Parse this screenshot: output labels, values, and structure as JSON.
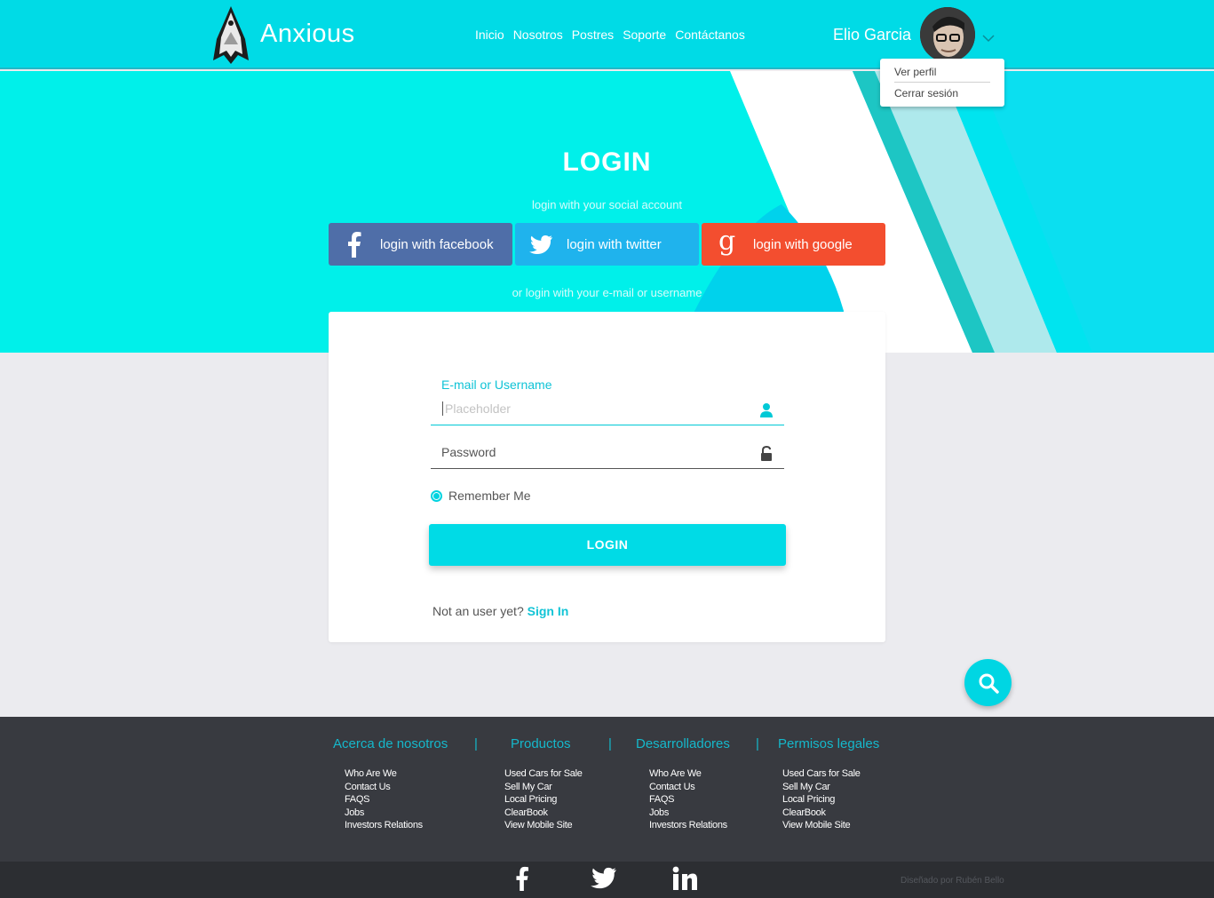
{
  "header": {
    "brand": "Anxious",
    "nav": [
      "Inicio",
      "Nosotros",
      "Postres",
      "Soporte",
      "Contáctanos"
    ],
    "user_name": "Elio Garcia",
    "dropdown": [
      "Ver perfil",
      "Cerrar sesión"
    ]
  },
  "hero": {
    "title": "LOGIN",
    "social_caption": "login with your social account",
    "alt_caption": "or login with your e-mail or username",
    "facebook_label": "login with facebook",
    "twitter_label": "login with twitter",
    "google_label": "login with google"
  },
  "form": {
    "email_label": "E-mail or Username",
    "email_placeholder": "Placeholder",
    "password_placeholder": "Password",
    "remember": "Remember Me",
    "login_button": "LOGIN",
    "signup_text": "Not an user yet?",
    "signup_link": "Sign In"
  },
  "footer": {
    "columns": [
      {
        "title": "Acerca de nosotros",
        "items": [
          "Who Are We",
          "Contact Us",
          "FAQS",
          "Jobs",
          "Investors Relations"
        ]
      },
      {
        "title": "Productos",
        "items": [
          "Used Cars for Sale",
          "Sell My Car",
          "Local Pricing",
          "ClearBook",
          "View Mobile Site"
        ]
      },
      {
        "title": "Desarrolladores",
        "items": [
          "Who Are We",
          "Contact Us",
          "FAQS",
          "Jobs",
          "Investors Relations"
        ]
      },
      {
        "title": "Permisos legales",
        "items": [
          "Used Cars for Sale",
          "Sell My Car",
          "Local Pricing",
          "ClearBook",
          "View Mobile Site"
        ]
      }
    ],
    "separator": "|",
    "credit": "Diseñado por Rubén Bello"
  },
  "colors": {
    "accent": "#00dbe6",
    "facebook": "#4f6ea8",
    "twitter": "#1fb3ed",
    "google": "#f34e2f",
    "footer_bg": "#383a40"
  }
}
